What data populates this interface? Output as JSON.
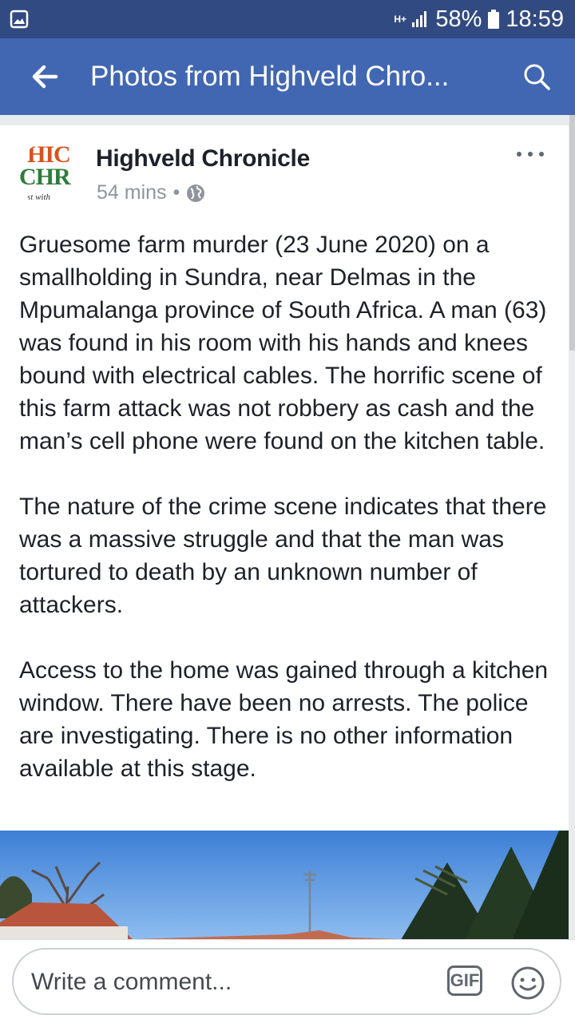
{
  "status_bar": {
    "network": "H+",
    "battery": "58%",
    "time": "18:59",
    "icons": [
      "gallery-icon",
      "signal-icon",
      "battery-icon"
    ]
  },
  "app_bar": {
    "title": "Photos from Highveld Chro...",
    "icons": [
      "back-arrow-icon",
      "search-icon"
    ]
  },
  "post": {
    "logo_text": {
      "top": "HIC",
      "middle": "CHR",
      "bottom": "st with"
    },
    "author": "Highveld Chronicle",
    "time": "54 mins",
    "separator": "•",
    "privacy_icon": "globe-icon",
    "paragraphs": [
      "Gruesome farm murder (23 June 2020) on a smallholding in Sundra, near Delmas in the Mpumalanga province of South Africa. A man (63) was found in his room with his hands and knees bound with electrical cables. The horrific scene of this farm attack was not robbery as cash and the man’s cell phone were found on the kitchen table.",
      "The nature of the crime scene indicates that there was a massive struggle and that the man was tortured to death by an unknown number of attackers.",
      "Access to the home was gained through a kitchen window. There have been no arrests. The police are investigating. There is no other information available at this stage."
    ]
  },
  "comment_bar": {
    "placeholder": "Write a comment...",
    "gif_label": "GIF",
    "emoji_icon": "smiley-icon"
  },
  "colors": {
    "status_bar": "#324a82",
    "app_bar": "#4267b2",
    "text": "#1d2129",
    "meta": "#90949c"
  }
}
